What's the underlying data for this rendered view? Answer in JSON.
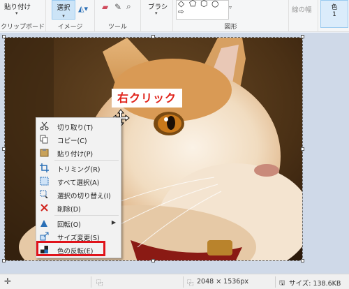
{
  "ribbon": {
    "paste_label": "貼り付け",
    "clipboard_group": "クリップボード",
    "select_label": "選択",
    "image_group": "イメージ",
    "tools_group": "ツール",
    "brush_label": "ブラシ",
    "shapes_group": "図形",
    "outline_label": "線の幅",
    "color1_label": "色",
    "color1_index": "1"
  },
  "callout": {
    "text": "右クリック",
    "color": "#e0231b"
  },
  "context_menu": {
    "items": [
      {
        "label": "切り取り(T)",
        "icon": "scissors-icon",
        "has_submenu": false
      },
      {
        "label": "コピー(C)",
        "icon": "copy-icon",
        "has_submenu": false
      },
      {
        "label": "貼り付け(P)",
        "icon": "paste-icon",
        "has_submenu": false
      },
      {
        "label": "トリミング(R)",
        "icon": "crop-icon",
        "has_submenu": false
      },
      {
        "label": "すべて選択(A)",
        "icon": "select-all-icon",
        "has_submenu": false
      },
      {
        "label": "選択の切り替え(I)",
        "icon": "invert-selection-icon",
        "has_submenu": false
      },
      {
        "label": "削除(D)",
        "icon": "delete-icon",
        "has_submenu": false
      },
      {
        "label": "回転(O)",
        "icon": "rotate-icon",
        "has_submenu": true
      },
      {
        "label": "サイズ変更(S)",
        "icon": "resize-icon",
        "has_submenu": false
      },
      {
        "label": "色の反転(E)",
        "icon": "invert-color-icon",
        "has_submenu": false,
        "highlighted": true
      }
    ],
    "highlight_color": "#e0131a"
  },
  "status_bar": {
    "dimensions": "2048 × 1536px",
    "size": "サイズ: 138.6KB"
  }
}
